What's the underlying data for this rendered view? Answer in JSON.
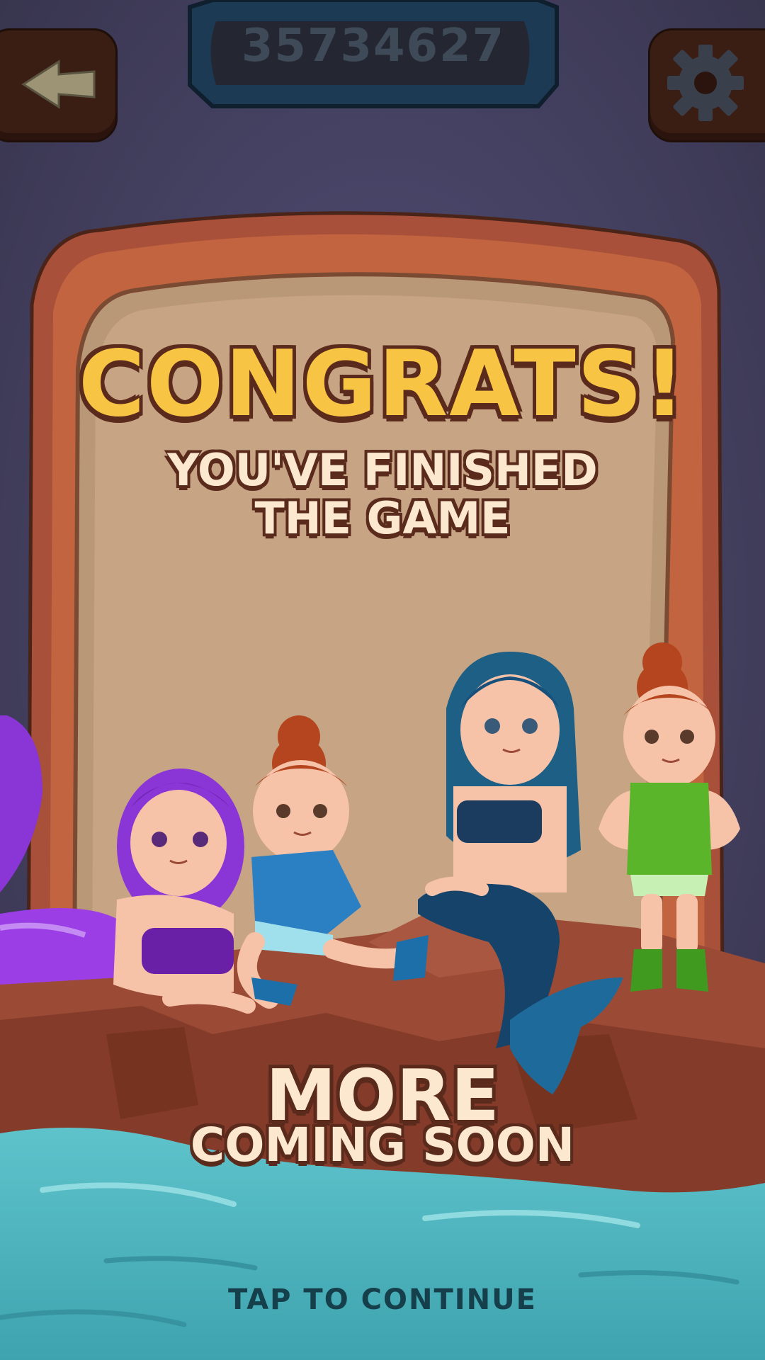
{
  "hud": {
    "score": "35734627",
    "back_icon": "back-arrow-icon",
    "settings_icon": "gear-icon"
  },
  "panel": {
    "title": "CONGRATS!",
    "subtitle_line1": "YOU'VE FINISHED",
    "subtitle_line2": "THE GAME"
  },
  "footer": {
    "more": "MORE",
    "coming_soon": "COMING SOON",
    "tap_to_continue": "TAP TO CONTINUE"
  },
  "colors": {
    "background": "#3d3a52",
    "title_yellow": "#f7c443",
    "cream_text": "#fbe8cf",
    "outline_brown": "#5a2a1c",
    "water": "#4eb3bd",
    "rock": "#9a4a35"
  }
}
